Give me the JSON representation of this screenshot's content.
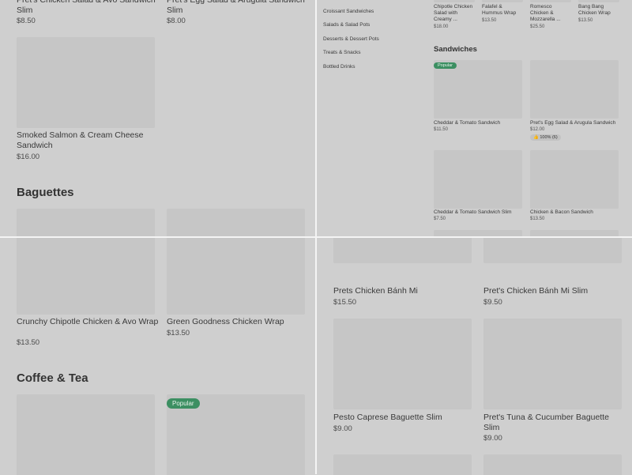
{
  "top_left": {
    "top_items": [
      {
        "name": "Pret's Chicken Salad & Avo Sandwich Slim",
        "price": "$8.50"
      },
      {
        "name": "Pret's Egg Salad & Arugula Sandwich Slim",
        "price": "$8.00"
      }
    ],
    "item3": {
      "name": "Smoked Salmon & Cream Cheese Sandwich",
      "price": "$16.00"
    },
    "section": "Baguettes"
  },
  "top_right": {
    "menu": [
      "Croissant Sandwiches",
      "Salads & Salad Pots",
      "Desserts & Dessert Pots",
      "Treats & Snacks",
      "Bottled Drinks"
    ],
    "mini_items": [
      {
        "name": "Chipotle Chicken Salad with Creamy ...",
        "price": "$18.00"
      },
      {
        "name": "Falafel & Hummus Wrap",
        "price": "$13.50"
      },
      {
        "name": "Romesco Chicken & Mozzarella ...",
        "price": "$25.50"
      },
      {
        "name": "Bang Bang Chicken Wrap",
        "price": "$13.50"
      }
    ],
    "section": "Sandwiches",
    "popular": "Popular",
    "cards": [
      {
        "name": "Cheddar & Tomato Sandwich",
        "price": "$11.50"
      },
      {
        "name": "Pret's Egg Salad & Arugula Sandwich",
        "price": "$12.00",
        "rating": "👍 100% (6)"
      },
      {
        "name": "Cheddar & Tomato Sandwich Slim",
        "price": "$7.50"
      },
      {
        "name": "Chicken & Bacon Sandwich",
        "price": "$13.50"
      }
    ]
  },
  "bottom_left": {
    "items": [
      {
        "name": "Crunchy Chipotle Chicken & Avo Wrap",
        "price": "$13.50"
      },
      {
        "name": "Green Goodness Chicken Wrap",
        "price": "$13.50"
      }
    ],
    "section": "Coffee & Tea",
    "popular": "Popular"
  },
  "bottom_right": {
    "items": [
      {
        "name": "Prets Chicken Bánh Mi",
        "price": "$15.50"
      },
      {
        "name": "Pret's Chicken Bánh Mi Slim",
        "price": "$9.50"
      },
      {
        "name": "Pesto Caprese Baguette Slim",
        "price": "$9.00"
      },
      {
        "name": "Pret's Tuna & Cucumber Baguette Slim",
        "price": "$9.00"
      }
    ]
  }
}
